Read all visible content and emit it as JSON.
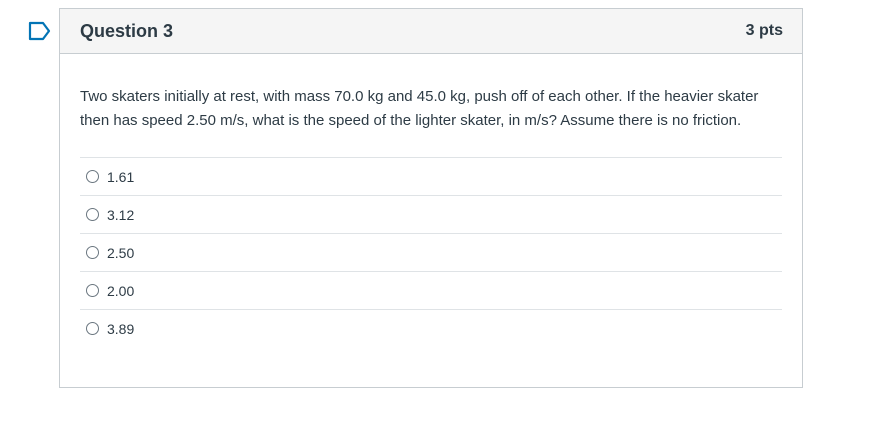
{
  "question": {
    "title": "Question 3",
    "points": "3 pts",
    "text": "Two skaters initially at rest, with mass 70.0 kg and 45.0 kg, push off of each other. If the heavier skater then has speed 2.50 m/s, what is the speed of the lighter skater, in m/s? Assume there is no friction.",
    "answers": [
      {
        "label": "1.61"
      },
      {
        "label": "3.12"
      },
      {
        "label": "2.50"
      },
      {
        "label": "2.00"
      },
      {
        "label": "3.89"
      }
    ]
  },
  "colors": {
    "flag": "#0374b5",
    "header_bg": "#f5f5f5",
    "border": "#c7cdd1",
    "text": "#2d3b45"
  },
  "icons": {
    "flag": "flag-question-icon",
    "radio": "radio-button-icon"
  }
}
